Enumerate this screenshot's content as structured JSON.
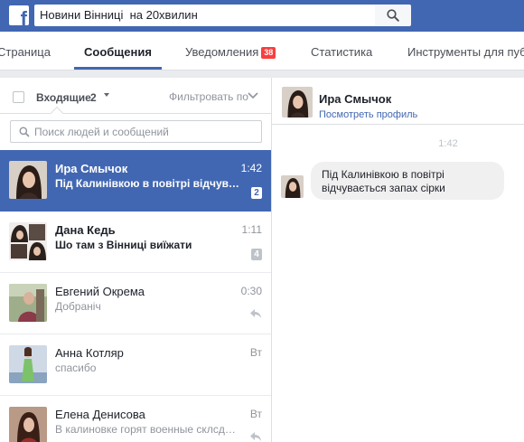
{
  "topbar": {
    "logo_letter": "f",
    "search_value": "Новини Вінниці  на 20хвилин"
  },
  "tabs": {
    "items": [
      {
        "label": "Страница"
      },
      {
        "label": "Сообщения"
      },
      {
        "label": "Уведомления"
      },
      {
        "label": "Статистика"
      },
      {
        "label": "Инструменты для пуб"
      }
    ],
    "notifications_badge": "38",
    "active_tab": "Сообщения"
  },
  "inbox": {
    "label": "Входящие",
    "count": "2",
    "filter_label": "Фильтровать по",
    "search_placeholder": "Поиск людей и сообщений"
  },
  "conversations": [
    {
      "name": "Ира Смычок",
      "snippet": "Під Калинівкою в повітрі відчуває…",
      "time": "1:42",
      "badge": "2",
      "avatar_icon": "woman-portrait-dark"
    },
    {
      "name": "Дана Кедь",
      "snippet": "Шо там з Вінниці виїжати",
      "time": "1:11",
      "badge": "4",
      "avatar_icon": "woman-collage"
    },
    {
      "name": "Евгений Окрема",
      "snippet": "Добраніч",
      "time": "0:30",
      "avatar_icon": "man-portrait-outdoor"
    },
    {
      "name": "Анна Котляр",
      "snippet": "спасибо",
      "time": "Вт",
      "avatar_icon": "woman-green-dress"
    },
    {
      "name": "Елена Денисова",
      "snippet": "В калиновке горят военные склсды....",
      "time": "Вт",
      "avatar_icon": "woman-portrait-red"
    }
  ],
  "chat": {
    "name": "Ира Смычок",
    "profile_link": "Посмотреть профиль",
    "time": "1:42",
    "message": "Під Калинівкою в повітрі відчувається запах сірки"
  },
  "colors": {
    "brand": "#4267b2",
    "badge_red": "#fa3e3e",
    "page_bg": "#e9ebee"
  }
}
